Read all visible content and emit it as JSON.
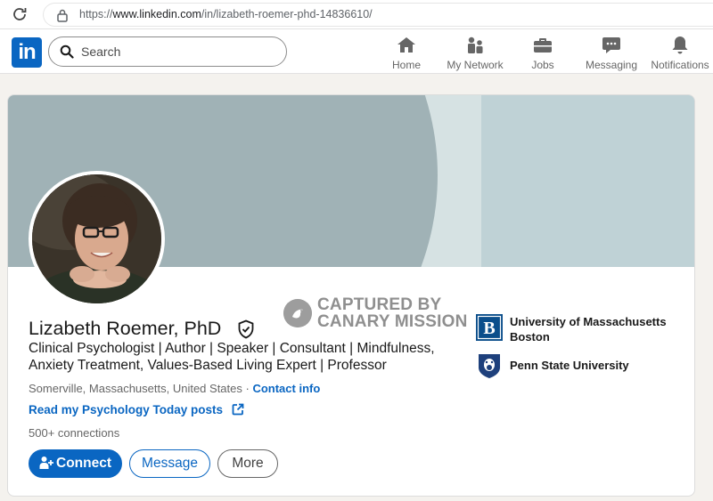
{
  "browser": {
    "url_prefix": "https://",
    "url_domain": "www.linkedin.com",
    "url_path": "/in/lizabeth-roemer-phd-14836610/"
  },
  "nav": {
    "logo": "in",
    "search_placeholder": "Search",
    "items": [
      {
        "label": "Home",
        "icon": "home-icon"
      },
      {
        "label": "My Network",
        "icon": "network-icon"
      },
      {
        "label": "Jobs",
        "icon": "briefcase-icon"
      },
      {
        "label": "Messaging",
        "icon": "messaging-icon"
      },
      {
        "label": "Notifications",
        "icon": "bell-icon"
      }
    ]
  },
  "profile": {
    "name": "Lizabeth Roemer, PhD",
    "headline": "Clinical Psychologist | Author | Speaker | Consultant | Mindfulness, Anxiety Treatment, Values-Based Living Expert | Professor",
    "location": "Somerville, Massachusetts, United States",
    "location_separator": " · ",
    "contact_info": "Contact info",
    "external_link": "Read my Psychology Today posts",
    "connections": "500+ connections",
    "buttons": {
      "connect": "Connect",
      "message": "Message",
      "more": "More"
    }
  },
  "education": [
    {
      "name": "University of Massachusetts Boston",
      "logo": "umass-boston-logo",
      "logo_letter": "B",
      "logo_color": "#0b4e8b"
    },
    {
      "name": "Penn State University",
      "logo": "penn-state-logo",
      "logo_color": "#1e407c"
    }
  ],
  "watermark": {
    "line1": "CAPTURED BY",
    "line2": "CANARY MISSION"
  },
  "colors": {
    "brand": "#0a66c2",
    "banner_dark": "#a0b2b6",
    "banner_light": "#d6e2e3",
    "banner_right": "#bfd2d6"
  }
}
